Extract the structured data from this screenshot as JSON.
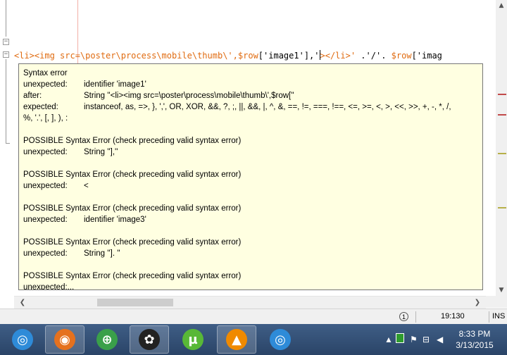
{
  "editor": {
    "code_segments": [
      {
        "text": "<li><img src=\\poster\\process\\mobile\\thumb\\',",
        "cls": "tag"
      },
      {
        "text": "$row",
        "cls": "var"
      },
      {
        "text": "['image1'],'",
        "cls": "str"
      },
      {
        "text": "|",
        "cls": "cursor"
      },
      {
        "text": "></li>'",
        "cls": "tag"
      },
      {
        "text": " .'/'. ",
        "cls": "str"
      },
      {
        "text": "$row",
        "cls": "var"
      },
      {
        "text": "['imag",
        "cls": "str"
      }
    ]
  },
  "tooltip": {
    "title": "Syntax error",
    "unexpected_key": "unexpected:",
    "unexpected_val": "identifier 'image1'",
    "after_key": "after:",
    "after_val": "String ''<li><img src=\\poster\\process\\mobile\\thumb\\',$row[''",
    "expected_key": "expected:",
    "expected_val": "instanceof, as, =>, }, ',', OR, XOR, &&, ?, ;, ||, &&, |, ^, &, ==, !=, ===, !==, <=, >=, <, >, <<, >>, +, -, *, /,",
    "expected_cont": "%, '.', [, ], ), :",
    "p1_title": "POSSIBLE Syntax Error (check preceding valid syntax error)",
    "p1_key": "unexpected:",
    "p1_val": "String ''],''",
    "p2_title": "POSSIBLE Syntax Error (check preceding valid syntax error)",
    "p2_key": "unexpected:",
    "p2_val": "<",
    "p3_title": "POSSIBLE Syntax Error (check preceding valid syntax error)",
    "p3_key": "unexpected:",
    "p3_val": "identifier 'image3'",
    "p4_title": "POSSIBLE Syntax Error (check preceding valid syntax error)",
    "p4_key": "unexpected:",
    "p4_val": "String '']. ''",
    "p5_title": "POSSIBLE Syntax Error (check preceding valid syntax error)",
    "p5_more": "unexpected:..."
  },
  "statusbar": {
    "notification_count": "1",
    "position": "19:130",
    "mode": "INS"
  },
  "taskbar": {
    "apps": [
      {
        "name": "safari-icon",
        "glyph": "◎",
        "color": "#2e8bd8",
        "active": false
      },
      {
        "name": "firefox-icon",
        "glyph": "◉",
        "color": "#e5711e",
        "active": true
      },
      {
        "name": "lock-app-icon",
        "glyph": "⊕",
        "color": "#3aa04a",
        "active": false
      },
      {
        "name": "color-wheel-icon",
        "glyph": "✿",
        "color": "#222222",
        "active": true
      },
      {
        "name": "utorrent-icon",
        "glyph": "µ",
        "color": "#58b837",
        "active": false
      },
      {
        "name": "vlc-icon",
        "glyph": "▲",
        "color": "#f08a00",
        "active": true
      },
      {
        "name": "safari-icon-2",
        "glyph": "◎",
        "color": "#2e8bd8",
        "active": false
      }
    ],
    "time": "8:33 PM",
    "date": "3/13/2015"
  }
}
